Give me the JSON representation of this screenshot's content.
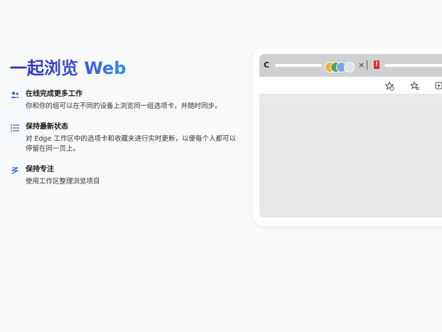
{
  "hero": {
    "title": "一起浏览 Web"
  },
  "features": [
    {
      "icon": "people-icon",
      "title": "在线完成更多工作",
      "desc": "你和你的组可以在不同的设备上浏览同一组选项卡，并随时同步。"
    },
    {
      "icon": "list-icon",
      "title": "保持最新状态",
      "desc": "对 Edge 工作区中的选项卡和收藏夹进行实时更新，以便每个人都可以停留在同一页上。"
    },
    {
      "icon": "focus-icon",
      "title": "保持专注",
      "desc": "使用工作区整理浏览项目"
    }
  ],
  "mock": {
    "workspace_glyph": "C",
    "tab_close": "×",
    "tab_mark": "!"
  },
  "colors": {
    "title_gradient_start": "#2c2bb8",
    "title_gradient_end": "#2f8ff0",
    "icon_blue": "#2f6fd1",
    "page_bg": "#f8f9fb"
  }
}
